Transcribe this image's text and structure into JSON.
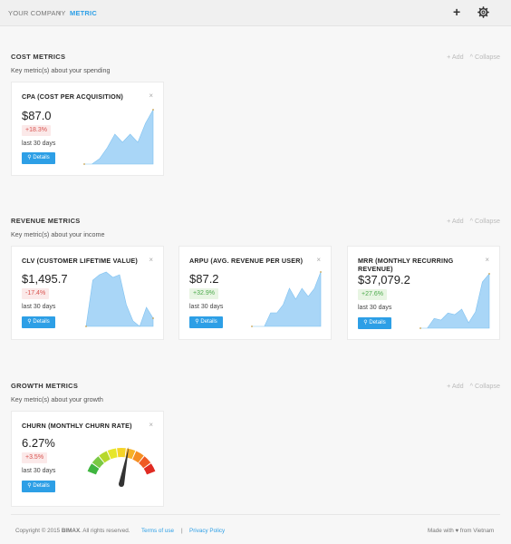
{
  "breadcrumb": {
    "company": "YOUR COMPANY",
    "separator": "›",
    "current": "METRIC"
  },
  "topbar": {
    "add_icon": "plus-icon",
    "settings_icon": "gear-icon",
    "add_label": "+"
  },
  "sections": [
    {
      "title": "COST METRICS",
      "subtitle": "Key metric(s) about your spending",
      "add": "+ Add",
      "collapse": "^ Collapse"
    },
    {
      "title": "REVENUE METRICS",
      "subtitle": "Key metric(s) about your income",
      "add": "+ Add",
      "collapse": "^ Collapse"
    },
    {
      "title": "GROWTH METRICS",
      "subtitle": "Key metric(s) about your growth",
      "add": "+ Add",
      "collapse": "^ Collapse"
    }
  ],
  "cards": {
    "cpa": {
      "title": "CPA (COST PER ACQUISITION)",
      "value": "$87.0",
      "change": "+18.3%",
      "period": "last 30 days",
      "button": "Details",
      "close": "×",
      "spark": [
        0,
        0,
        10,
        30,
        55,
        40,
        55,
        40,
        75,
        100
      ],
      "trend": "red"
    },
    "clv": {
      "title": "CLV (CUSTOMER LIFETIME VALUE)",
      "value": "$1,495.7",
      "change": "-17.4%",
      "period": "last 30 days",
      "button": "Details",
      "close": "×",
      "spark": [
        0,
        85,
        95,
        100,
        90,
        95,
        40,
        10,
        0,
        35,
        15
      ],
      "trend": "red"
    },
    "arpu": {
      "title": "ARPU (AVG. REVENUE PER USER)",
      "value": "$87.2",
      "change": "+32.9%",
      "period": "last 30 days",
      "button": "Details",
      "close": "×",
      "spark": [
        0,
        0,
        0,
        25,
        25,
        40,
        70,
        50,
        70,
        55,
        70,
        100
      ],
      "trend": "green"
    },
    "mrr": {
      "title": "MRR (MONTHLY RECURRING REVENUE)",
      "value": "$37,079.2",
      "change": "+27.6%",
      "period": "last 30 days",
      "button": "Details",
      "close": "×",
      "spark": [
        0,
        0,
        18,
        15,
        28,
        25,
        35,
        10,
        30,
        85,
        100
      ],
      "trend": "green"
    },
    "churn": {
      "title": "CHURN (MONTHLY CHURN RATE)",
      "value": "6.27%",
      "change": "+3.5%",
      "period": "last 30 days",
      "button": "Details",
      "close": "×",
      "gauge_level": 0.58,
      "gauge_colors": [
        "#3fb53f",
        "#7ac943",
        "#b6d82c",
        "#e6e62a",
        "#f5d327",
        "#f7b125",
        "#f58e23",
        "#ef5a24",
        "#e02b22"
      ]
    }
  },
  "colors": {
    "accent": "#2d9fe6",
    "spark_fill": "#a9d6f7",
    "spark_stroke": "#7fc1f0",
    "dot": "#c9a14a"
  },
  "footer": {
    "copyright": "Copyright © 2015",
    "brand": "BIMAX",
    "rights": ". All rights reserved.",
    "terms": "Terms of use",
    "divider": "|",
    "privacy": "Privacy Policy",
    "made_with": "Made with ♥ from Vietnam"
  }
}
